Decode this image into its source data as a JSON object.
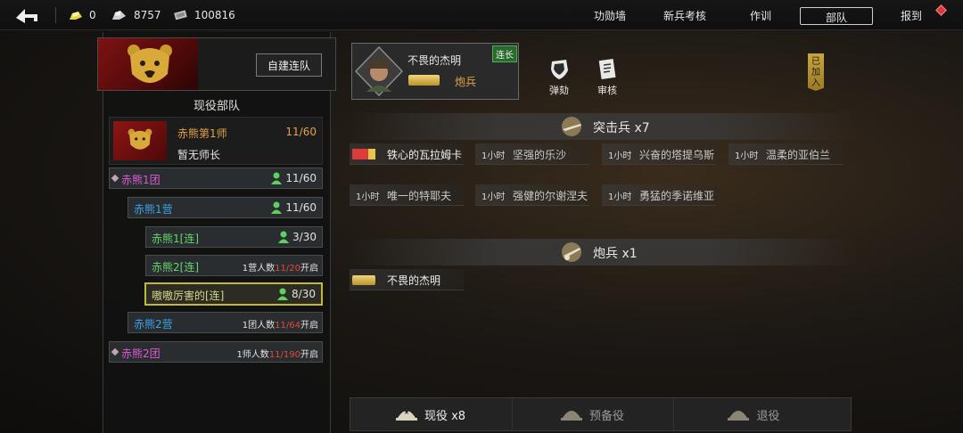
{
  "topbar": {
    "resources": [
      {
        "icon": "gold-bar-icon",
        "value": "0"
      },
      {
        "icon": "silver-ingot-icon",
        "value": "8757"
      },
      {
        "icon": "cash-icon",
        "value": "100816"
      }
    ],
    "nav_tabs": [
      {
        "label": "功勋墙",
        "active": false
      },
      {
        "label": "新兵考核",
        "active": false
      },
      {
        "label": "作训",
        "active": false
      },
      {
        "label": "部队",
        "active": true
      },
      {
        "label": "报到",
        "active": false
      }
    ]
  },
  "left": {
    "create_button": "自建连队",
    "section_title": "现役部队",
    "division": {
      "name": "赤熊第1师",
      "count": "11/60",
      "commander": "暂无师长"
    },
    "units": [
      {
        "name": "赤熊1团",
        "count": "11/60"
      },
      {
        "name": "赤熊1营",
        "count": "11/60"
      },
      {
        "name": "赤熊1[连]",
        "count": "3/30"
      },
      {
        "name": "赤熊2[连]",
        "req_prefix": "1营人数",
        "req_value": "11/20",
        "req_suffix": "开启"
      },
      {
        "name": "嗷嗷厉害的[连]",
        "count": "8/30"
      },
      {
        "name": "赤熊2营",
        "req_prefix": "1团人数",
        "req_value": "11/64",
        "req_suffix": "开启"
      },
      {
        "name": "赤熊2团",
        "req_prefix": "1师人数",
        "req_value": "11/190",
        "req_suffix": "开启"
      }
    ]
  },
  "officer": {
    "name": "不畏的杰明",
    "role": "连长",
    "branch": "炮兵"
  },
  "actions": {
    "impeach": "弹劾",
    "review": "审核"
  },
  "joined_tag": "已加入",
  "groups": [
    {
      "title": "突击兵 x7",
      "soldiers": [
        {
          "time": "",
          "name": "铁心的瓦拉姆卡"
        },
        {
          "time": "1小时",
          "name": "坚强的乐沙"
        },
        {
          "time": "1小时",
          "name": "兴奋的塔提乌斯"
        },
        {
          "time": "1小时",
          "name": "温柔的亚伯兰"
        },
        {
          "time": "1小时",
          "name": "唯一的特耶夫"
        },
        {
          "time": "1小时",
          "name": "强健的尔谢涅夫"
        },
        {
          "time": "1小时",
          "name": "勇猛的季诺维亚"
        }
      ]
    },
    {
      "title": "炮兵 x1",
      "soldiers": [
        {
          "time": "",
          "name": "不畏的杰明"
        }
      ]
    }
  ],
  "bottom_tabs": [
    {
      "label": "现役 x8",
      "active": true
    },
    {
      "label": "预备役",
      "active": false
    },
    {
      "label": "退役",
      "active": false
    }
  ]
}
